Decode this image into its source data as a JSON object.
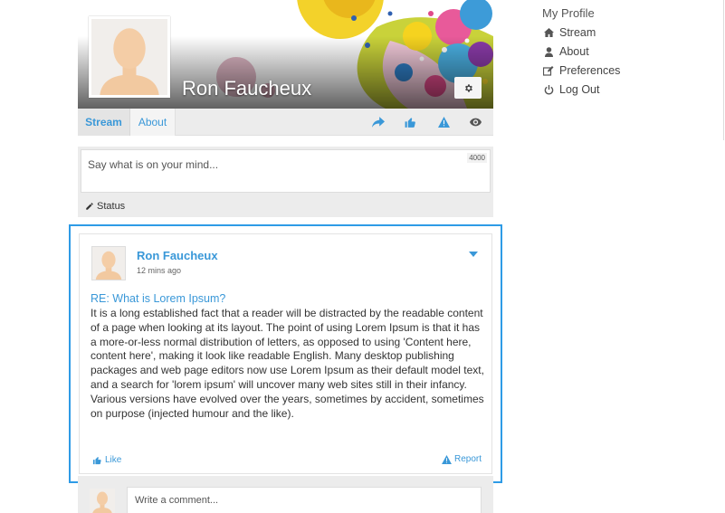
{
  "profile": {
    "name": "Ron Faucheux"
  },
  "tabs": {
    "stream": "Stream",
    "about": "About"
  },
  "composer": {
    "placeholder": "Say what is on your mind...",
    "char_count": "4000",
    "status_label": "Status"
  },
  "post": {
    "author": "Ron Faucheux",
    "time": "12 mins ago",
    "title": "RE: What is Lorem Ipsum?",
    "body": "It is a long established fact that a reader will be distracted by the readable content of a page when looking at its layout. The point of using Lorem Ipsum is that it has a more-or-less normal distribution of letters, as opposed to using 'Content here, content here', making it look like readable English. Many desktop publishing packages and web page editors now use Lorem Ipsum as their default model text, and a search for 'lorem ipsum' will uncover many web sites still in their infancy. Various versions have evolved over the years, sometimes by accident, sometimes on purpose (injected humour and the like).",
    "like_label": "Like",
    "report_label": "Report"
  },
  "comment": {
    "placeholder": "Write a comment..."
  },
  "sidebar": {
    "title": "My Profile",
    "items": [
      {
        "label": "Stream",
        "icon": "home-icon"
      },
      {
        "label": "About",
        "icon": "user-icon"
      },
      {
        "label": "Preferences",
        "icon": "edit-icon"
      },
      {
        "label": "Log Out",
        "icon": "power-icon"
      }
    ]
  },
  "colors": {
    "accent": "#3a98d8",
    "highlight": "#2e9be6",
    "panel": "#ececec"
  }
}
